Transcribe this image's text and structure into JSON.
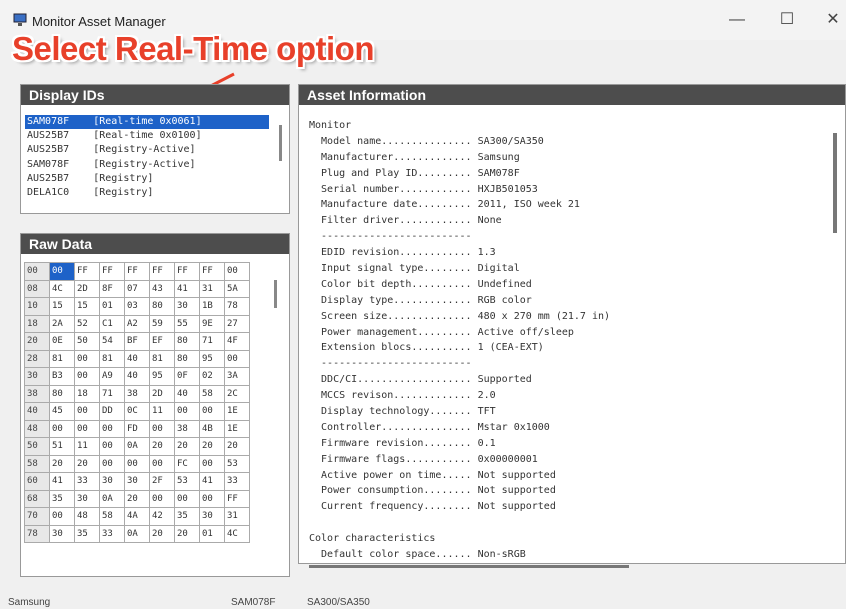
{
  "window": {
    "title": "Monitor Asset Manager",
    "min_glyph": "—",
    "max_glyph": "☐",
    "close_glyph": "✕"
  },
  "annotation": {
    "text": "Select Real-Time option",
    "color": "#e8402a"
  },
  "display_ids": {
    "heading": "Display IDs",
    "items": [
      {
        "text": "SAM078F    [Real-time 0x0061]",
        "selected": true
      },
      {
        "text": "AUS25B7    [Real-time 0x0100]"
      },
      {
        "text": "AUS25B7    [Registry-Active]"
      },
      {
        "text": "SAM078F    [Registry-Active]"
      },
      {
        "text": "AUS25B7    [Registry]"
      },
      {
        "text": "DELA1C0    [Registry]"
      }
    ]
  },
  "raw_data": {
    "heading": "Raw Data",
    "rows": [
      [
        "00",
        "00",
        "FF",
        "FF",
        "FF",
        "FF",
        "FF",
        "FF",
        "00"
      ],
      [
        "08",
        "4C",
        "2D",
        "8F",
        "07",
        "43",
        "41",
        "31",
        "5A"
      ],
      [
        "10",
        "15",
        "15",
        "01",
        "03",
        "80",
        "30",
        "1B",
        "78"
      ],
      [
        "18",
        "2A",
        "52",
        "C1",
        "A2",
        "59",
        "55",
        "9E",
        "27"
      ],
      [
        "20",
        "0E",
        "50",
        "54",
        "BF",
        "EF",
        "80",
        "71",
        "4F"
      ],
      [
        "28",
        "81",
        "00",
        "81",
        "40",
        "81",
        "80",
        "95",
        "00"
      ],
      [
        "30",
        "B3",
        "00",
        "A9",
        "40",
        "95",
        "0F",
        "02",
        "3A"
      ],
      [
        "38",
        "80",
        "18",
        "71",
        "38",
        "2D",
        "40",
        "58",
        "2C"
      ],
      [
        "40",
        "45",
        "00",
        "DD",
        "0C",
        "11",
        "00",
        "00",
        "1E"
      ],
      [
        "48",
        "00",
        "00",
        "00",
        "FD",
        "00",
        "38",
        "4B",
        "1E"
      ],
      [
        "50",
        "51",
        "11",
        "00",
        "0A",
        "20",
        "20",
        "20",
        "20"
      ],
      [
        "58",
        "20",
        "20",
        "00",
        "00",
        "00",
        "FC",
        "00",
        "53"
      ],
      [
        "60",
        "41",
        "33",
        "30",
        "30",
        "2F",
        "53",
        "41",
        "33"
      ],
      [
        "68",
        "35",
        "30",
        "0A",
        "20",
        "00",
        "00",
        "00",
        "FF"
      ],
      [
        "70",
        "00",
        "48",
        "58",
        "4A",
        "42",
        "35",
        "30",
        "31"
      ],
      [
        "78",
        "30",
        "35",
        "33",
        "0A",
        "20",
        "20",
        "01",
        "4C"
      ]
    ]
  },
  "asset_info": {
    "heading": "Asset Information",
    "lines": [
      "Monitor",
      "  Model name............... SA300/SA350",
      "  Manufacturer............. Samsung",
      "  Plug and Play ID......... SAM078F",
      "  Serial number............ HXJB501053",
      "  Manufacture date......... 2011, ISO week 21",
      "  Filter driver............ None",
      "  -------------------------",
      "  EDID revision............ 1.3",
      "  Input signal type........ Digital",
      "  Color bit depth.......... Undefined",
      "  Display type............. RGB color",
      "  Screen size.............. 480 x 270 mm (21.7 in)",
      "  Power management......... Active off/sleep",
      "  Extension blocs.......... 1 (CEA-EXT)",
      "  -------------------------",
      "  DDC/CI................... Supported",
      "  MCCS revison............. 2.0",
      "  Display technology....... TFT",
      "  Controller............... Mstar 0x1000",
      "  Firmware revision........ 0.1",
      "  Firmware flags........... 0x00000001",
      "  Active power on time..... Not supported",
      "  Power consumption........ Not supported",
      "  Current frequency........ Not supported",
      "",
      "Color characteristics",
      "  Default color space...... Non-sRGB"
    ]
  },
  "status_bar": {
    "manufacturer": "Samsung",
    "pnp_id": "SAM078F",
    "model": "SA300/SA350"
  }
}
